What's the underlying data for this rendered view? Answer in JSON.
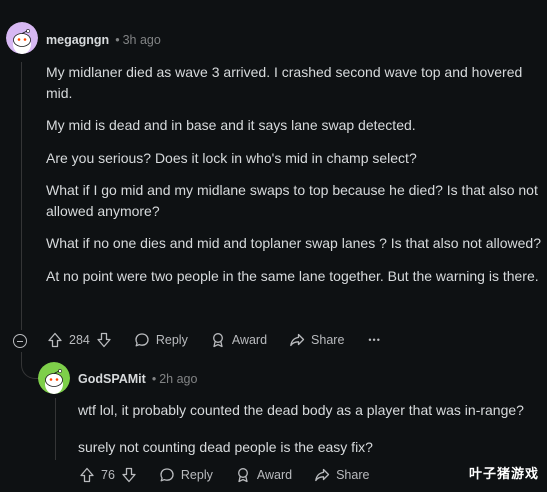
{
  "comment": {
    "username": "megagngn",
    "dot": "•",
    "time": "3h ago",
    "paragraphs": [
      "My midlaner died as wave 3 arrived. I crashed second wave top and hovered mid.",
      "My mid is dead and in base and it says lane swap detected.",
      "Are you serious? Does it lock in who's mid in champ select?",
      "What if I go mid and my midlane swaps to top because he died? Is that also not allowed anymore?",
      "What if no one dies and mid and toplaner swap lanes ? Is that also not allowed?",
      "At no point were two people in the same lane together. But the warning is there."
    ],
    "votes": "284",
    "reply_label": "Reply",
    "award_label": "Award",
    "share_label": "Share",
    "more_label": "•••",
    "avatar_color": "#d7b8f3"
  },
  "reply": {
    "username": "GodSPAMit",
    "dot": "•",
    "time": "2h ago",
    "paragraphs": [
      "wtf lol, it probably counted the dead body as a player that was in-range?",
      "surely not counting dead people is the easy fix?"
    ],
    "votes": "76",
    "reply_label": "Reply",
    "award_label": "Award",
    "share_label": "Share",
    "avatar_color": "#7ecf4a"
  },
  "watermark": "叶子猪游戏"
}
